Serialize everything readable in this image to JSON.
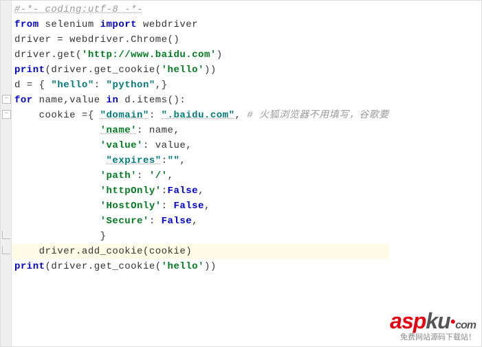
{
  "code": {
    "l1_comment": "#-*- coding:utf-8 -*-",
    "l2_kw1": "from",
    "l2_pkg": " selenium ",
    "l2_kw2": "import",
    "l2_mod": " webdriver",
    "l3": "driver = webdriver.Chrome()",
    "l4_a": "driver.get(",
    "l4_str": "'http://www.baidu.com'",
    "l4_b": ")",
    "l5_a": "print",
    "l5_b": "(driver.get_cookie(",
    "l5_str": "'hello'",
    "l5_c": "))",
    "l6_a": "d = { ",
    "l6_k": "\"hello\"",
    "l6_b": ": ",
    "l6_v": "\"python\"",
    "l6_c": ",}",
    "l7_kw1": "for",
    "l7_a": " name,value ",
    "l7_kw2": "in",
    "l7_b": " d.items():",
    "l8_a": "    cookie ={ ",
    "l8_k": "\"domain\"",
    "l8_b": ": ",
    "l8_v": "\".baidu.com\"",
    "l8_c": ", ",
    "l8_cmt": "# 火狐浏览器不用填写，谷歌要",
    "l9_pad": "              ",
    "l9_k": "'name'",
    "l9_b": ": name,",
    "l10_pad": "              ",
    "l10_k": "'value'",
    "l10_b": ": value,",
    "l11_pad": "               ",
    "l11_k": "\"expires\"",
    "l11_b": ":",
    "l11_v": "\"\"",
    "l11_c": ",",
    "l12_pad": "              ",
    "l12_k": "'path'",
    "l12_b": ": ",
    "l12_v": "'/'",
    "l12_c": ",",
    "l13_pad": "              ",
    "l13_k": "'httpOnly'",
    "l13_b": ":",
    "l13_v": "False",
    "l13_c": ",",
    "l14_pad": "              ",
    "l14_k": "'HostOnly'",
    "l14_b": ": ",
    "l14_v": "False",
    "l14_c": ",",
    "l15_pad": "              ",
    "l15_k": "'Secure'",
    "l15_b": ": ",
    "l15_v": "False",
    "l15_c": ",",
    "l16_pad": "              ",
    "l16_b": "}",
    "l17": "    driver.add_cookie(cookie)",
    "l18_a": "print",
    "l18_b": "(driver.get_cookie(",
    "l18_str": "'hello'",
    "l18_c": "))"
  },
  "watermark": {
    "brand_red": "asp",
    "brand_gray": "ku",
    "dot": "●",
    "domain": "com",
    "subtitle": "免费网站源码下载站！"
  }
}
